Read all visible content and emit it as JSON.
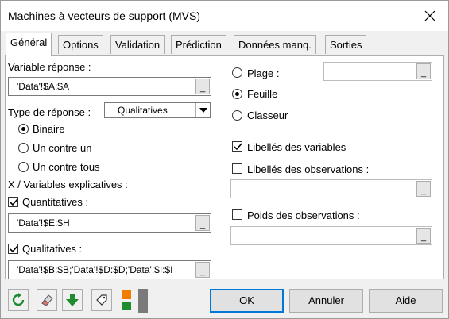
{
  "window": {
    "title": "Machines à vecteurs de support (MVS)"
  },
  "tabs": [
    "Général",
    "Options",
    "Validation",
    "Prédiction",
    "Données manq.",
    "Sorties"
  ],
  "general": {
    "response_label": "Variable réponse :",
    "response_value": "'Data'!$A:$A",
    "response_type_label": "Type de réponse :",
    "response_type_value": "Qualitatives",
    "mode_options": [
      "Binaire",
      "Un contre un",
      "Un contre tous"
    ],
    "mode_selected": "Binaire",
    "explanatory_label": "X / Variables explicatives :",
    "quantitative_label": "Quantitatives :",
    "quantitative_checked": true,
    "quantitative_value": "'Data'!$E:$H",
    "qualitative_label": "Qualitatives :",
    "qualitative_checked": true,
    "qualitative_value": "'Data'!$B:$B;'Data'!$D:$D;'Data'!$I:$I",
    "output_options": [
      "Plage :",
      "Feuille",
      "Classeur"
    ],
    "output_selected": "Feuille",
    "var_labels": "Libellés des variables",
    "var_labels_checked": true,
    "obs_labels": "Libellés des observations :",
    "obs_labels_checked": false,
    "obs_weights": "Poids des observations :",
    "obs_weights_checked": false
  },
  "footer": {
    "ok": "OK",
    "cancel": "Annuler",
    "help": "Aide",
    "icons": [
      "reset-icon",
      "eraser-icon",
      "down-arrow-icon",
      "tag-icon",
      "color-blocks-icon"
    ]
  },
  "colors": {
    "accent": "#0078d7",
    "green": "#1e8c2f",
    "orange": "#f07d00"
  }
}
